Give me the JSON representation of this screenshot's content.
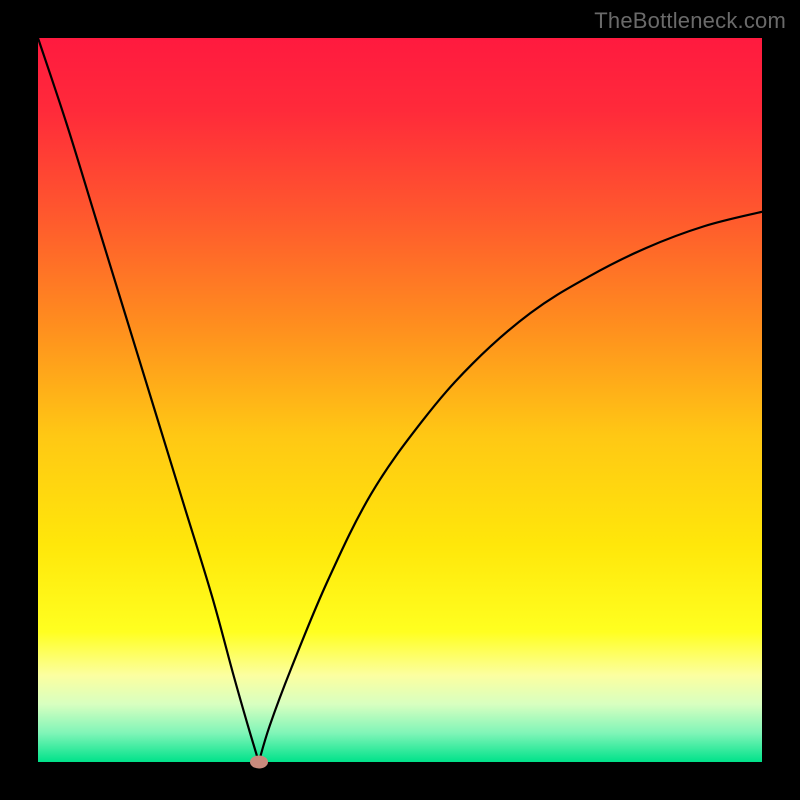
{
  "watermark": "TheBottleneck.com",
  "colors": {
    "black": "#000000",
    "curve": "#000000",
    "marker": "#c98a7d",
    "gradient_stops": [
      {
        "offset": 0.0,
        "color": "#ff1a3f"
      },
      {
        "offset": 0.1,
        "color": "#ff2a3a"
      },
      {
        "offset": 0.25,
        "color": "#ff5a2d"
      },
      {
        "offset": 0.4,
        "color": "#ff8f1e"
      },
      {
        "offset": 0.55,
        "color": "#ffc814"
      },
      {
        "offset": 0.7,
        "color": "#ffe70a"
      },
      {
        "offset": 0.82,
        "color": "#ffff20"
      },
      {
        "offset": 0.88,
        "color": "#fcffa0"
      },
      {
        "offset": 0.92,
        "color": "#d8ffc0"
      },
      {
        "offset": 0.96,
        "color": "#80f5b8"
      },
      {
        "offset": 1.0,
        "color": "#00e28a"
      }
    ]
  },
  "chart_data": {
    "type": "line",
    "title": "",
    "xlabel": "",
    "ylabel": "",
    "xlim": [
      0,
      100
    ],
    "ylim": [
      0,
      100
    ],
    "series": [
      {
        "name": "bottleneck-curve-left",
        "x": [
          0,
          4,
          8,
          12,
          16,
          20,
          24,
          27,
          29,
          30.5
        ],
        "values": [
          100,
          88,
          75,
          62,
          49,
          36,
          23,
          12,
          5,
          0
        ]
      },
      {
        "name": "bottleneck-curve-right",
        "x": [
          30.5,
          32,
          35,
          40,
          46,
          53,
          60,
          68,
          76,
          84,
          92,
          100
        ],
        "values": [
          0,
          5,
          13,
          25,
          37,
          47,
          55,
          62,
          67,
          71,
          74,
          76
        ]
      }
    ],
    "annotations": [
      {
        "name": "vertex-marker",
        "x": 30.5,
        "y": 0
      }
    ]
  }
}
